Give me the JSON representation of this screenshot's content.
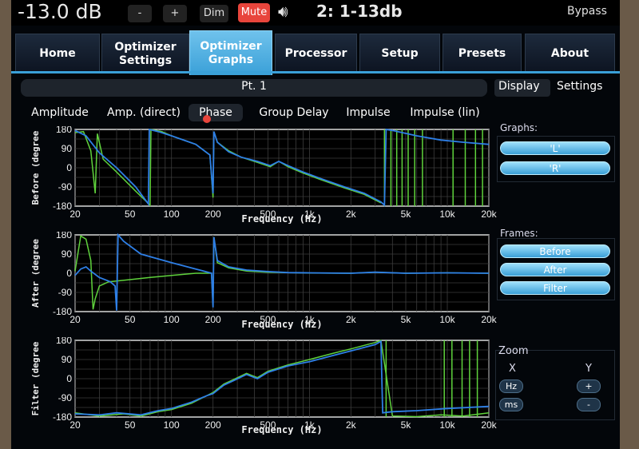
{
  "topbar": {
    "volume": "-13.0 dB",
    "minus_label": "-",
    "plus_label": "+",
    "dim_label": "Dim",
    "mute_label": "Mute",
    "preset": "2: 1-13db",
    "bypass_label": "Bypass",
    "mute_color": "#e8453c"
  },
  "nav": {
    "tabs": [
      {
        "label": "Home"
      },
      {
        "label": "Optimizer Settings"
      },
      {
        "label": "Optimizer Graphs"
      },
      {
        "label": "Processor"
      },
      {
        "label": "Setup"
      },
      {
        "label": "Presets"
      },
      {
        "label": "About"
      }
    ],
    "active_index": 2,
    "accent": "#3aa0d8"
  },
  "point_title": "Pt. 1",
  "subtabs": [
    {
      "label": "Amplitude"
    },
    {
      "label": "Amp. (direct)"
    },
    {
      "label": "Phase"
    },
    {
      "label": "Group Delay"
    },
    {
      "label": "Impulse"
    },
    {
      "label": "Impulse (lin)"
    }
  ],
  "active_subtab": 2,
  "graphs": [
    {
      "ylabel": "Before (degree",
      "xlabel": "Frequency (Hz)",
      "yticks": [
        "180",
        "90",
        "0",
        "-90",
        "-180"
      ],
      "xticks": [
        "20",
        "50",
        "100",
        "200",
        "500",
        "1k",
        "2k",
        "5k",
        "10k",
        "20k"
      ]
    },
    {
      "ylabel": "After (degree",
      "xlabel": "Frequency (Hz)",
      "yticks": [
        "180",
        "90",
        "0",
        "-90",
        "-180"
      ],
      "xticks": [
        "20",
        "50",
        "100",
        "200",
        "500",
        "1k",
        "2k",
        "5k",
        "10k",
        "20k"
      ]
    },
    {
      "ylabel": "Filter (degree",
      "xlabel": "Frequency (Hz)",
      "yticks": [
        "180",
        "90",
        "0",
        "-90",
        "-180"
      ],
      "xticks": [
        "20",
        "50",
        "100",
        "200",
        "500",
        "1k",
        "2k",
        "5k",
        "10k",
        "20k"
      ]
    }
  ],
  "series_colors": {
    "L": "#5fd23c",
    "R": "#2e7fe6"
  },
  "right_panel": {
    "tabs": [
      {
        "label": "Display"
      },
      {
        "label": "Settings"
      }
    ],
    "graphs_title": "Graphs:",
    "graph_buttons": [
      {
        "label": "'L'"
      },
      {
        "label": "'R'"
      }
    ],
    "frames_title": "Frames:",
    "frame_buttons": [
      {
        "label": "Before"
      },
      {
        "label": "After"
      },
      {
        "label": "Filter"
      }
    ],
    "zoom_title": "Zoom",
    "zoom_x": "X",
    "zoom_y": "Y",
    "zoom_hz": "Hz",
    "zoom_ms": "ms",
    "zoom_plus": "+",
    "zoom_minus": "-"
  }
}
